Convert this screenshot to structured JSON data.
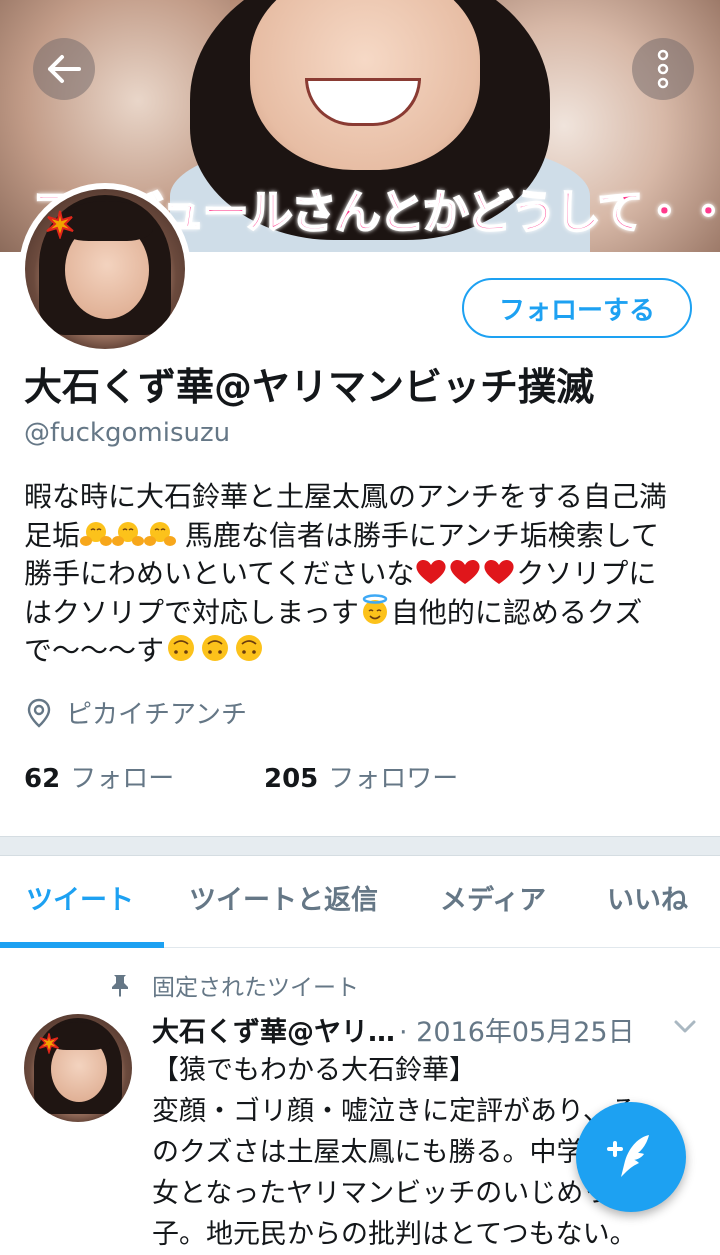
{
  "banner": {
    "caption": "スケジュールさんとかどうして・・・"
  },
  "profile": {
    "follow_label": "フォローする",
    "name": "大石くず華@ヤリマンビッチ撲滅",
    "handle": "@fuckgomisuzu",
    "bio": {
      "line1": "暇な時に大石鈴華と土屋太鳳のアンチをする自己満",
      "line2_a": "足垢",
      "line2_b": " 馬鹿な信者は勝手にアンチ垢検索して",
      "line3_a": "勝手にわめいといてくださいな",
      "line3_b": "クソリプに",
      "line4_a": "はクソリプで対応しまっす",
      "line4_b": "自他的に認めるクズ",
      "line5_a": "で〜〜〜す"
    },
    "location": "ピカイチアンチ",
    "following_count": "62",
    "following_label": "フォロー",
    "followers_count": "205",
    "followers_label": "フォロワー"
  },
  "tabs": [
    {
      "label": "ツイート"
    },
    {
      "label": "ツイートと返信"
    },
    {
      "label": "メディア"
    },
    {
      "label": "いいね"
    }
  ],
  "pinned_tweet": {
    "pinned_label": "固定されたツイート",
    "name": "大石くず華@ヤリ…",
    "date": "· 2016年05月25日",
    "lines": [
      "【猿でもわかる大石鈴華】",
      "変顔・ゴリ顔・嘘泣きに定評があり、そ",
      "のクズさは土屋太鳳にも勝る。中学で魔",
      "女となったヤリマンビッチのいじめっ",
      "子。地元民からの批判はとてつもない。"
    ]
  },
  "colors": {
    "accent": "#1da1f2",
    "secondary_text": "#657786"
  },
  "icons": [
    "back-arrow-icon",
    "more-vertical-icon",
    "location-pin-icon",
    "pin-icon",
    "chevron-down-icon",
    "compose-tweet-icon"
  ]
}
